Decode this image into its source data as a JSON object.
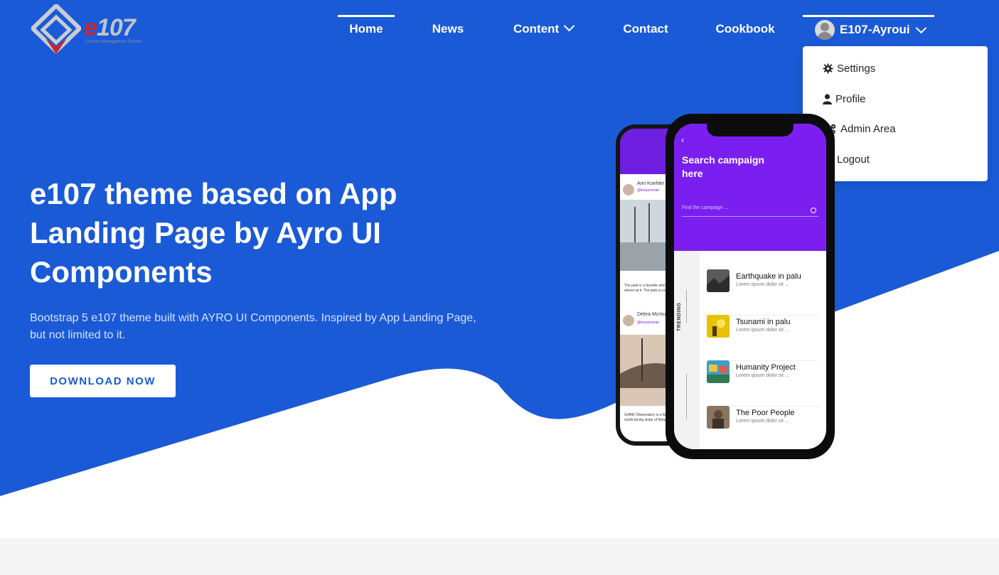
{
  "brand": {
    "logo_text_main": "e",
    "logo_text_num": "107",
    "logo_sub": "Content Management System"
  },
  "nav": {
    "items": [
      {
        "label": "Home",
        "active": true
      },
      {
        "label": "News"
      },
      {
        "label": "Content",
        "has_dropdown": true
      },
      {
        "label": "Contact"
      },
      {
        "label": "Cookbook"
      }
    ],
    "user": {
      "name": "E107-Ayroui"
    }
  },
  "user_menu": {
    "items": [
      {
        "label": "Settings",
        "icon": "gear-icon"
      },
      {
        "label": "Profile",
        "icon": "user-icon"
      },
      {
        "label": "Admin Area",
        "icon": "gears-icon"
      },
      {
        "label": "Logout",
        "icon": "power-icon"
      }
    ]
  },
  "hero": {
    "title": "e107 theme based on App Landing Page by Ayro UI Components",
    "description": "Bootstrap 5 e107 theme built with AYRO UI Components. Inspired by App Landing Page, but not limited to it.",
    "cta_label": "DOWNLOAD NOW"
  },
  "phone_back": {
    "posts": [
      {
        "user": "Ami Koehler",
        "handle": "@koopersnak",
        "text": "The park is a favorite among skat... eleven at it. The park is complete..."
      },
      {
        "user": "Debra Mcmunn",
        "handle": "@koopersnak",
        "text": "Griffith Observatory is a facility in... the south-facing slope of Mount..."
      }
    ]
  },
  "phone_front": {
    "back_glyph": "‹",
    "search_title": "Search campaign here",
    "search_placeholder": "Find the campaign ...",
    "trending_label": "TRENDING",
    "items": [
      {
        "title": "Earthquake in palu",
        "sub": "Lorem ipsum dolor sit ..."
      },
      {
        "title": "Tsunami in palu",
        "sub": "Lorem ipsum dolor sit ..."
      },
      {
        "title": "Humanity Project",
        "sub": "Lorem ipsum dolor sit ..."
      },
      {
        "title": "The Poor People",
        "sub": "Lorem ipsum dolor sit ..."
      }
    ]
  },
  "colors": {
    "primary_blue": "#1a5ad6",
    "purple": "#7a1ff0",
    "white": "#ffffff"
  }
}
